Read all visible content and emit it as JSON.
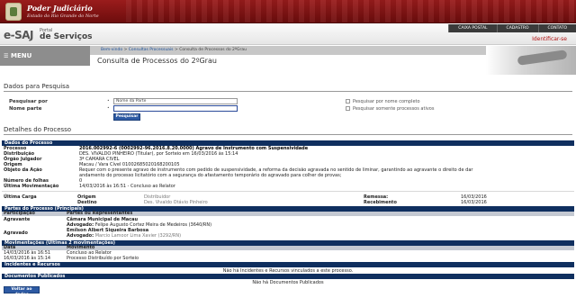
{
  "header": {
    "org_title": "Poder Judiciário",
    "org_subtitle": "Estado do Rio Grande do Norte"
  },
  "brand": {
    "logo_main": "e-SAJ",
    "logo_portal": "Portal",
    "logo_services": "de Serviços",
    "nav": [
      "CAIXA POSTAL",
      "CADASTRO",
      "CONTATO"
    ],
    "identify": "Identificar-se"
  },
  "menu": {
    "label": "MENU",
    "icon": "hamburger-icon"
  },
  "breadcrumb": {
    "home": "Bem-vindo",
    "consultas": "Consultas Processuais",
    "current": "Consulta de Processos do 2ºGrau"
  },
  "page_title": "Consulta de Processos do 2ºGrau",
  "dados_pesquisa": {
    "title": "Dados para Pesquisa",
    "pesquisar_label": "Pesquisar por",
    "pesquisar_value": "Nome da Parte",
    "nome_label": "Nome parte",
    "nome_value": "",
    "check_nome_completo": "Pesquisar por nome completo",
    "check_ativos": "Pesquisar somente processos ativos",
    "button": "Pesquisar"
  },
  "detalhes": {
    "title": "Detalhes do Processo",
    "dados_header": "Dados do Processo",
    "fields": [
      {
        "label": "Processo",
        "value": "2016.002992-6 (0002992-96.2016.8.20.0000)  Agravo de Instrumento com Suspensividade"
      },
      {
        "label": "Distribuição",
        "value": "DES. VIVALDO PINHEIRO (Titular), por Sorteio em 16/03/2016  às 15:14"
      },
      {
        "label": "Órgão Julgador",
        "value": "3ª CAMARA CIVEL"
      },
      {
        "label": "Origem",
        "value": "Macau / Vara Cível 0100268502016820010​5"
      },
      {
        "label": "Objeto da Ação",
        "value": "Requer com o presente agravo de instrumento com pedido de suspensividade, a reforma da decisão agravada no sentido de liminar, garantindo ao agravante o direito de dar"
      },
      {
        "label": "",
        "value": "andamento do processo licitatório com a segurança do afastamento temporário do agravado para colher de provas;"
      },
      {
        "label": "Número de folhas",
        "value": "0"
      },
      {
        "label": "Última Movimentação",
        "value": "14/03/2016 às 16:51 - Concluso ao Relator"
      }
    ],
    "ultima_carga": {
      "label": "Última Carga",
      "origem_label": "Origem",
      "origem_value": "Distribuidor",
      "destino_label": "Destino",
      "destino_value": "Des. Vivaldo Otávio Pinheiro",
      "remessa_label": "Remessa:",
      "remessa_value": "16/03/2016",
      "recebimento_label": "Recebimento",
      "recebimento_value": "16/03/2016"
    },
    "partes_header": "Partes do Processo (Principais)",
    "partes_cols": [
      "Participação",
      "Partes ou Representantes"
    ],
    "partes": [
      {
        "role": "Agravante",
        "name": "Câmara Municipal de Macau",
        "adv_label": "Advogado:",
        "adv": "Felipe Augusto Cortez Meira de Medeiros (3640/RN)"
      },
      {
        "role": "Agravado",
        "name": "Emílson Albert Siqueira Barbosa",
        "adv_label": "Advogado:",
        "adv": "Marcio Lamoor Lima Xavier (3292/RN)"
      }
    ],
    "mov_header": "Movimentações (Últimas 2 movimentações)",
    "mov_cols": [
      "Data",
      "Movimento"
    ],
    "movimentacoes": [
      {
        "data": "14/03/2016 às 16:51",
        "mov": "Concluso ao Relator"
      },
      {
        "data": "16/03/2016 às 15:14",
        "mov": "Processo Distribuído por Sorteio"
      }
    ],
    "incidentes_header": "Incidentes e Recursos",
    "incidentes_empty": "Não há Incidentes e Recursos vinculados a este processo.",
    "documentos_header": "Documentos Publicados",
    "documentos_empty": "Não há Documentos Publicados",
    "back_button": "Voltar ao dados"
  },
  "colors": {
    "header_red": "#8b1414",
    "table_header_navy": "#0f2f5f",
    "button_blue": "#2d5aa3"
  }
}
